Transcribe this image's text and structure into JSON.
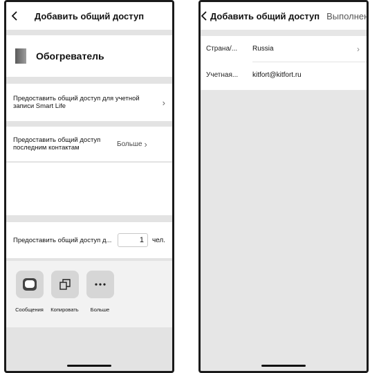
{
  "left": {
    "title": "Добавить общий доступ",
    "device_name": "Обогреватель",
    "share_smart_life": "Предоставить общий доступ для учетной записи Smart Life",
    "share_recent": "Предоставить общий доступ последним контактам",
    "more_label": "Больше",
    "share_count_label": "Предоставить общий доступ д...",
    "count_value": "1",
    "count_unit": "чел.",
    "actions": [
      {
        "label": "Сообщения",
        "icon": "message-icon"
      },
      {
        "label": "Копировать",
        "icon": "copy-icon"
      },
      {
        "label": "Больше",
        "icon": "more-icon"
      }
    ]
  },
  "right": {
    "title": "Добавить общий доступ",
    "done": "Выполнено",
    "rows": [
      {
        "key": "Страна/...",
        "value": "Russia"
      },
      {
        "key": "Учетная...",
        "value": "kitfort@kitfort.ru"
      }
    ]
  },
  "colors": {
    "background": "#e3e3e3",
    "panel": "#ffffff",
    "action_tile": "#d6d6d6"
  }
}
